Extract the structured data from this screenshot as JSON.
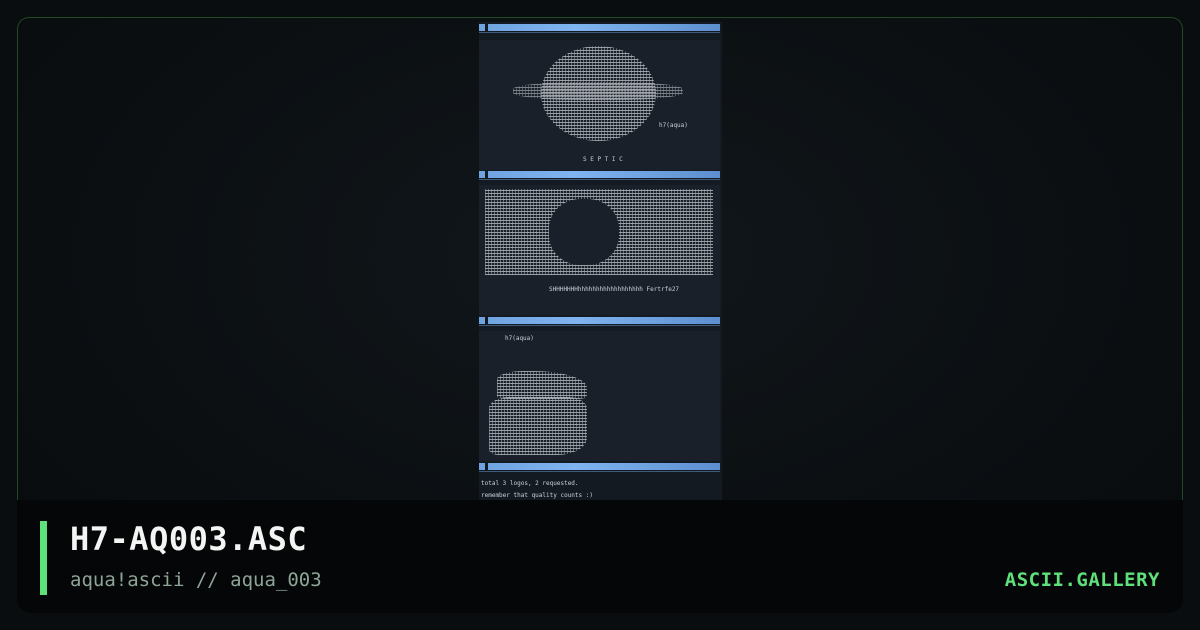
{
  "card": {
    "title": "H7-AQ003.ASC",
    "subtitle": "aqua!ascii // aqua_003",
    "brand": "ASCII.GALLERY",
    "accent_color": "#5ee07a",
    "background_color": "#0a0d0f",
    "border_color": "#1f4a25"
  },
  "preview": {
    "panel1_tag": "h7(aqua)",
    "panel1_caption": "S E P T I C",
    "panel2_caption": "SHHHHHHHhhhhhhhhhhhhhhhhhh Fertrfe27",
    "panel3_tag": "h7(aqua)",
    "footer_line1": "total 3 logos, 2 requested.",
    "footer_line2": "remember that quality counts :)"
  }
}
